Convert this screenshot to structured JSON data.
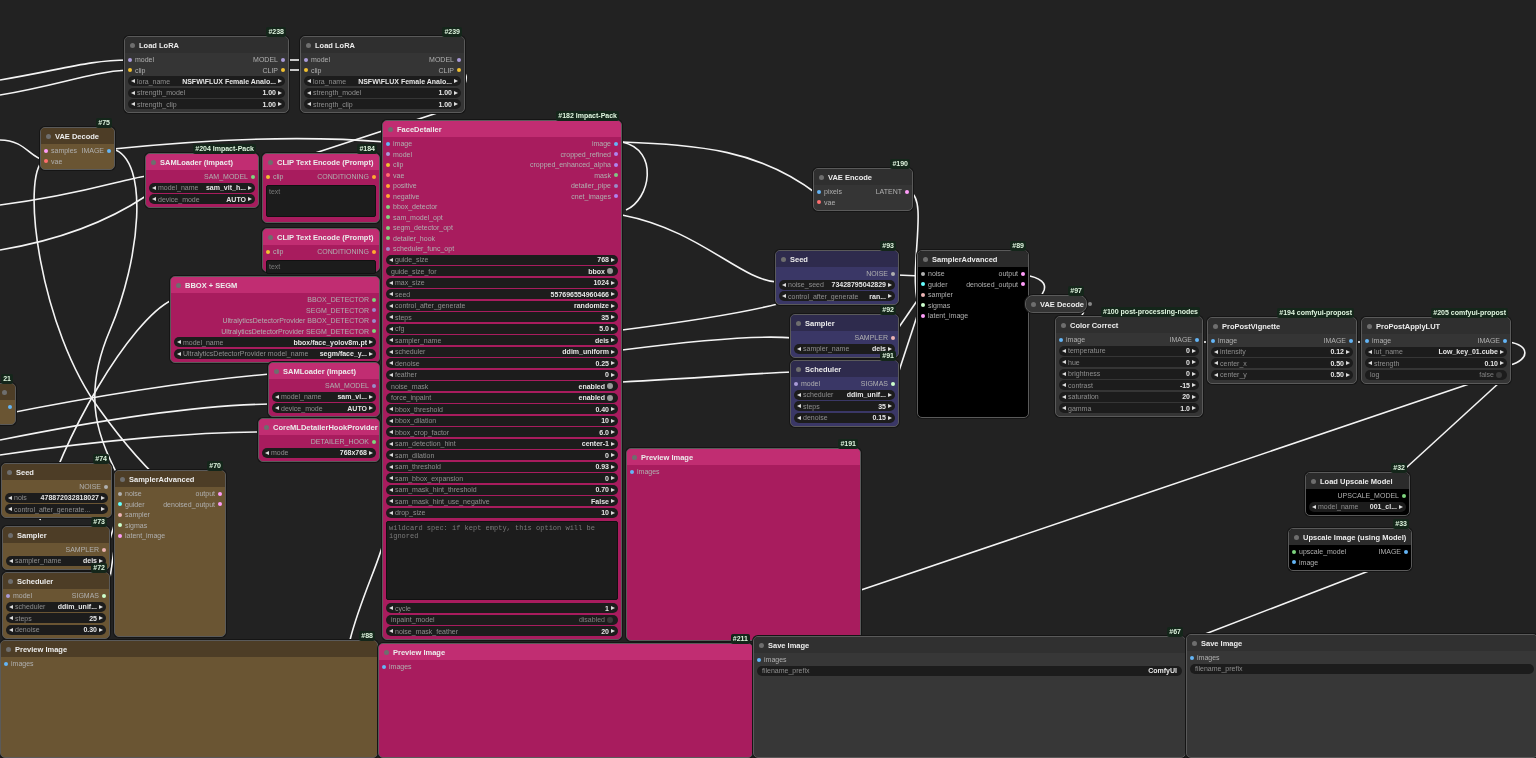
{
  "nodes": [
    {
      "title": "Load LoRA",
      "badge": "#238",
      "color": "#353535",
      "collapsed": false,
      "inputs": [
        {
          "label": "model",
          "color": "#a99bd8"
        },
        {
          "label": "clip",
          "color": "#f0c030"
        }
      ],
      "outputs": [
        {
          "label": "MODEL",
          "color": "#a99bd8"
        },
        {
          "label": "CLIP",
          "color": "#f0c030"
        }
      ],
      "widgets": [
        {
          "kind": "combo",
          "label": "lora_name",
          "value": "NSFW\\FLUX Female Analo..."
        },
        {
          "kind": "number",
          "label": "strength_model",
          "value": "1.00"
        },
        {
          "kind": "number",
          "label": "strength_clip",
          "value": "1.00"
        }
      ]
    },
    {
      "title": "Load LoRA",
      "badge": "#239",
      "color": "#353535",
      "collapsed": false,
      "inputs": [
        {
          "label": "model",
          "color": "#a99bd8"
        },
        {
          "label": "clip",
          "color": "#f0c030"
        }
      ],
      "outputs": [
        {
          "label": "MODEL",
          "color": "#a99bd8"
        },
        {
          "label": "CLIP",
          "color": "#f0c030"
        }
      ],
      "widgets": [
        {
          "kind": "combo",
          "label": "lora_name",
          "value": "NSFW\\FLUX Female Analo..."
        },
        {
          "kind": "number",
          "label": "strength_model",
          "value": "1.00"
        },
        {
          "kind": "number",
          "label": "strength_clip",
          "value": "1.00"
        }
      ]
    },
    {
      "title": "VAE Decode",
      "badge": "#75",
      "color": "#6a5533",
      "collapsed": false,
      "inputs": [
        {
          "label": "samples",
          "color": "#ff9cf9"
        },
        {
          "label": "vae",
          "color": "#ff6e6e"
        }
      ],
      "outputs": [
        {
          "label": "IMAGE",
          "color": "#64b5f6"
        }
      ]
    },
    {
      "title": "SAMLoader (Impact)",
      "badge": "#204 Impact-Pack",
      "color": "#a81c5e",
      "collapsed": false,
      "outputs": [
        {
          "label": "SAM_MODEL",
          "color": "#7ed57e"
        }
      ],
      "widgets": [
        {
          "kind": "combo",
          "label": "model_name",
          "value": "sam_vit_h..."
        },
        {
          "kind": "combo",
          "label": "device_mode",
          "value": "AUTO"
        }
      ]
    },
    {
      "title": "CLIP Text Encode (Prompt)",
      "badge": "#184",
      "color": "#a81c5e",
      "collapsed": false,
      "inputs": [
        {
          "label": "clip",
          "color": "#f0c030"
        }
      ],
      "outputs": [
        {
          "label": "CONDITIONING",
          "color": "#ffa931"
        }
      ],
      "widgets": [
        {
          "kind": "textarea",
          "placeholder": "text"
        }
      ]
    },
    {
      "title": "CLIP Text Encode (Prompt)",
      "color": "#a81c5e",
      "collapsed": false,
      "inputs": [
        {
          "label": "clip",
          "color": "#f0c030"
        }
      ],
      "outputs": [
        {
          "label": "CONDITIONING",
          "color": "#ffa931"
        }
      ],
      "widgets": [
        {
          "kind": "textarea",
          "placeholder": "text"
        }
      ]
    },
    {
      "title": "BBOX + SEGM",
      "color": "#a81c5e",
      "collapsed": false,
      "outputs": [
        {
          "label": "BBOX_DETECTOR",
          "color": "#7ed57e"
        },
        {
          "label": "SEGM_DETECTOR",
          "color": "#9a8cc8"
        },
        {
          "label": "UltralyticsDetectorProvider BBOX_DETECTOR",
          "color": "#9a8cc8"
        },
        {
          "label": "UltralyticsDetectorProvider SEGM_DETECTOR",
          "color": "#7ed57e"
        }
      ],
      "widgets": [
        {
          "kind": "combo",
          "label": "model_name",
          "value": "bbox/face_yolov8m.pt"
        },
        {
          "kind": "combo",
          "label": "UltralyticsDetectorProvider model_name",
          "value": "segm/face_y..."
        }
      ]
    },
    {
      "title": "SAMLoader (Impact)",
      "color": "#a81c5e",
      "collapsed": false,
      "outputs": [
        {
          "label": "SAM_MODEL",
          "color": "#9a8cc8"
        }
      ],
      "widgets": [
        {
          "kind": "combo",
          "label": "model_name",
          "value": "sam_vi..."
        },
        {
          "kind": "combo",
          "label": "device_mode",
          "value": "AUTO"
        }
      ]
    },
    {
      "title": "CoreMLDetailerHookProvider",
      "color": "#a81c5e",
      "collapsed": false,
      "outputs": [
        {
          "label": "DETAILER_HOOK",
          "color": "#7ed57e"
        }
      ],
      "widgets": [
        {
          "kind": "combo",
          "label": "mode",
          "value": "768x768"
        }
      ]
    },
    {
      "title": "FaceDetailer",
      "badge": "#182 Impact-Pack",
      "color": "#a81c5e",
      "collapsed": false,
      "inputs": [
        {
          "label": "image",
          "color": "#64b5f6"
        },
        {
          "label": "model",
          "color": "#a99bd8"
        },
        {
          "label": "clip",
          "color": "#f0c030"
        },
        {
          "label": "vae",
          "color": "#ff6e6e"
        },
        {
          "label": "positive",
          "color": "#ffa931"
        },
        {
          "label": "negative",
          "color": "#ffa931"
        },
        {
          "label": "bbox_detector",
          "color": "#7ed57e"
        },
        {
          "label": "sam_model_opt",
          "color": "#7ed57e"
        },
        {
          "label": "segm_detector_opt",
          "color": "#7ed57e"
        },
        {
          "label": "detailer_hook",
          "color": "#7ed57e"
        },
        {
          "label": "scheduler_func_opt",
          "color": "#9a8cc8"
        }
      ],
      "outputs": [
        {
          "label": "image",
          "color": "#64b5f6"
        },
        {
          "label": "cropped_refined",
          "color": "#b084f0"
        },
        {
          "label": "cropped_enhanced_alpha",
          "color": "#b084f0"
        },
        {
          "label": "mask",
          "color": "#81c784"
        },
        {
          "label": "detailer_pipe",
          "color": "#9a8cc8"
        },
        {
          "label": "cnet_images",
          "color": "#b084f0"
        }
      ],
      "widgets": [
        {
          "kind": "number",
          "label": "guide_size",
          "value": "768"
        },
        {
          "kind": "toggle",
          "label": "guide_size_for",
          "value": "bbox",
          "on": true
        },
        {
          "kind": "number",
          "label": "max_size",
          "value": "1024"
        },
        {
          "kind": "number",
          "label": "seed",
          "value": "557696554960466"
        },
        {
          "kind": "combo",
          "label": "control_after_generate",
          "value": "randomize"
        },
        {
          "kind": "number",
          "label": "steps",
          "value": "35"
        },
        {
          "kind": "number",
          "label": "cfg",
          "value": "5.0"
        },
        {
          "kind": "combo",
          "label": "sampler_name",
          "value": "deis"
        },
        {
          "kind": "combo",
          "label": "scheduler",
          "value": "ddim_uniform"
        },
        {
          "kind": "number",
          "label": "denoise",
          "value": "0.25"
        },
        {
          "kind": "number",
          "label": "feather",
          "value": "0"
        },
        {
          "kind": "toggle",
          "label": "noise_mask",
          "value": "enabled",
          "on": true
        },
        {
          "kind": "toggle",
          "label": "force_inpaint",
          "value": "enabled",
          "on": true
        },
        {
          "kind": "number",
          "label": "bbox_threshold",
          "value": "0.40"
        },
        {
          "kind": "number",
          "label": "bbox_dilation",
          "value": "10"
        },
        {
          "kind": "number",
          "label": "bbox_crop_factor",
          "value": "6.0"
        },
        {
          "kind": "combo",
          "label": "sam_detection_hint",
          "value": "center-1"
        },
        {
          "kind": "number",
          "label": "sam_dilation",
          "value": "0"
        },
        {
          "kind": "number",
          "label": "sam_threshold",
          "value": "0.93"
        },
        {
          "kind": "number",
          "label": "sam_bbox_expansion",
          "value": "0"
        },
        {
          "kind": "number",
          "label": "sam_mask_hint_threshold",
          "value": "0.70"
        },
        {
          "kind": "combo",
          "label": "sam_mask_hint_use_negative",
          "value": "False"
        },
        {
          "kind": "number",
          "label": "drop_size",
          "value": "10"
        },
        {
          "kind": "textarea",
          "placeholder": "wildcard spec: if kept empty, this option will be ignored"
        },
        {
          "kind": "number",
          "label": "cycle",
          "value": "1"
        },
        {
          "kind": "toggle",
          "label": "inpaint_model",
          "value": "disabled",
          "on": false
        },
        {
          "kind": "number",
          "label": "noise_mask_feather",
          "value": "20"
        }
      ]
    },
    {
      "title": "Preview Image",
      "badge": "#191",
      "color": "#a81c5e",
      "collapsed": false,
      "inputs": [
        {
          "label": "images",
          "color": "#64b5f6"
        }
      ]
    },
    {
      "title": "VAE Encode",
      "badge": "#190",
      "color": "#353535",
      "collapsed": false,
      "inputs": [
        {
          "label": "pixels",
          "color": "#64b5f6"
        },
        {
          "label": "vae",
          "color": "#ff6e6e"
        }
      ],
      "outputs": [
        {
          "label": "LATENT",
          "color": "#ff9cf9"
        }
      ]
    },
    {
      "title": "Seed",
      "badge": "#93",
      "color": "#3a3766",
      "collapsed": false,
      "outputs": [
        {
          "label": "NOISE",
          "color": "#b0b0b0"
        }
      ],
      "widgets": [
        {
          "kind": "number",
          "label": "noise_seed",
          "value": "73428795042829"
        },
        {
          "kind": "combo",
          "label": "control_after_generate",
          "value": "ran..."
        }
      ]
    },
    {
      "title": "Sampler",
      "badge": "#92",
      "color": "#3a3766",
      "collapsed": false,
      "outputs": [
        {
          "label": "SAMPLER",
          "color": "#ecb4b4"
        }
      ],
      "widgets": [
        {
          "kind": "combo",
          "label": "sampler_name",
          "value": "deis"
        }
      ]
    },
    {
      "title": "Scheduler",
      "badge": "#91",
      "color": "#3a3766",
      "collapsed": false,
      "inputs": [
        {
          "label": "model",
          "color": "#a99bd8"
        }
      ],
      "outputs": [
        {
          "label": "SIGMAS",
          "color": "#cdffcd"
        }
      ],
      "widgets": [
        {
          "kind": "combo",
          "label": "scheduler",
          "value": "ddim_unif..."
        },
        {
          "kind": "number",
          "label": "steps",
          "value": "35"
        },
        {
          "kind": "number",
          "label": "denoise",
          "value": "0.15"
        }
      ]
    },
    {
      "title": "SamplerAdvanced",
      "badge": "#89",
      "color": "#000000",
      "collapsed": false,
      "inputs": [
        {
          "label": "noise",
          "color": "#b0b0b0"
        },
        {
          "label": "guider",
          "color": "#66ffff"
        },
        {
          "label": "sampler",
          "color": "#ecb4b4"
        },
        {
          "label": "sigmas",
          "color": "#cdffcd"
        },
        {
          "label": "latent_image",
          "color": "#ff9cf9"
        }
      ],
      "outputs": [
        {
          "label": "output",
          "color": "#ff9cf9"
        },
        {
          "label": "denoised_output",
          "color": "#ff9cf9"
        }
      ]
    },
    {
      "title": "VAE Decode",
      "badge": "#97",
      "color": "#353535",
      "collapsed": true,
      "outputs": [
        {
          "color": "#888888"
        }
      ]
    },
    {
      "title": "Color Correct",
      "badge": "#100 post-processing-nodes",
      "color": "#353535",
      "collapsed": false,
      "inputs": [
        {
          "label": "image",
          "color": "#64b5f6"
        }
      ],
      "outputs": [
        {
          "label": "IMAGE",
          "color": "#64b5f6"
        }
      ],
      "widgets": [
        {
          "kind": "number",
          "label": "temperature",
          "value": "0"
        },
        {
          "kind": "number",
          "label": "hue",
          "value": "0"
        },
        {
          "kind": "number",
          "label": "brightness",
          "value": "0"
        },
        {
          "kind": "number",
          "label": "contrast",
          "value": "-15"
        },
        {
          "kind": "number",
          "label": "saturation",
          "value": "20"
        },
        {
          "kind": "number",
          "label": "gamma",
          "value": "1.0"
        }
      ]
    },
    {
      "title": "ProPostVignette",
      "badge": "#194 comfyui-propost",
      "color": "#353535",
      "collapsed": false,
      "inputs": [
        {
          "label": "image",
          "color": "#64b5f6"
        }
      ],
      "outputs": [
        {
          "label": "IMAGE",
          "color": "#64b5f6"
        }
      ],
      "widgets": [
        {
          "kind": "number",
          "label": "intensity",
          "value": "0.12"
        },
        {
          "kind": "number",
          "label": "center_x",
          "value": "0.50"
        },
        {
          "kind": "number",
          "label": "center_y",
          "value": "0.50"
        }
      ]
    },
    {
      "title": "ProPostApplyLUT",
      "badge": "#205 comfyui-propost",
      "color": "#353535",
      "collapsed": false,
      "inputs": [
        {
          "label": "image",
          "color": "#64b5f6"
        }
      ],
      "outputs": [
        {
          "label": "IMAGE",
          "color": "#64b5f6"
        }
      ],
      "widgets": [
        {
          "kind": "combo",
          "label": "lut_name",
          "value": "Low_key_01.cube"
        },
        {
          "kind": "number",
          "label": "strength",
          "value": "0.10"
        },
        {
          "kind": "toggle",
          "label": "log",
          "value": "false",
          "on": false
        }
      ]
    },
    {
      "title": "Load Upscale Model",
      "badge": "#32",
      "color": "#000000",
      "collapsed": false,
      "outputs": [
        {
          "label": "UPSCALE_MODEL",
          "color": "#7ed57e"
        }
      ],
      "widgets": [
        {
          "kind": "combo",
          "label": "model_name",
          "value": "001_cl..."
        }
      ]
    },
    {
      "title": "Upscale Image (using Model)",
      "badge": "#33",
      "color": "#000000",
      "collapsed": false,
      "inputs": [
        {
          "label": "upscale_model",
          "color": "#7ed57e"
        },
        {
          "label": "image",
          "color": "#64b5f6"
        }
      ],
      "outputs": [
        {
          "label": "IMAGE",
          "color": "#64b5f6"
        }
      ]
    },
    {
      "badge": "21",
      "color": "#6a5533",
      "collapsed": false,
      "outputs": [
        {
          "color": "#64b5f6"
        }
      ]
    },
    {
      "title": "Seed",
      "badge": "#74",
      "color": "#6a5533",
      "collapsed": false,
      "outputs": [
        {
          "label": "NOISE",
          "color": "#b0b0b0"
        }
      ],
      "widgets": [
        {
          "kind": "number",
          "label": "nois",
          "value": "478872032818027"
        },
        {
          "kind": "combo",
          "label": "control_after_generate..."
        }
      ]
    },
    {
      "title": "Sampler",
      "badge": "#73",
      "color": "#6a5533",
      "collapsed": false,
      "outputs": [
        {
          "label": "SAMPLER",
          "color": "#ecb4b4"
        }
      ],
      "widgets": [
        {
          "kind": "combo",
          "label": "sampler_name",
          "value": "deis"
        }
      ]
    },
    {
      "title": "Scheduler",
      "badge": "#72",
      "color": "#6a5533",
      "collapsed": false,
      "inputs": [
        {
          "label": "model",
          "color": "#a99bd8"
        }
      ],
      "outputs": [
        {
          "label": "SIGMAS",
          "color": "#cdffcd"
        }
      ],
      "widgets": [
        {
          "kind": "combo",
          "label": "scheduler",
          "value": "ddim_unif..."
        },
        {
          "kind": "number",
          "label": "steps",
          "value": "25"
        },
        {
          "kind": "number",
          "label": "denoise",
          "value": "0.30"
        }
      ]
    },
    {
      "title": "SamplerAdvanced",
      "badge": "#70",
      "color": "#6a5533",
      "collapsed": false,
      "inputs": [
        {
          "label": "noise",
          "color": "#b0b0b0"
        },
        {
          "label": "guider",
          "color": "#66ffff"
        },
        {
          "label": "sampler",
          "color": "#ecb4b4"
        },
        {
          "label": "sigmas",
          "color": "#cdffcd"
        },
        {
          "label": "latent_image",
          "color": "#ff9cf9"
        }
      ],
      "outputs": [
        {
          "label": "output",
          "color": "#ff9cf9"
        },
        {
          "label": "denoised_output",
          "color": "#ff9cf9"
        }
      ]
    },
    {
      "title": "Preview Image",
      "badge": "#88",
      "color": "#6a5533",
      "collapsed": false,
      "inputs": [
        {
          "label": "images",
          "color": "#64b5f6"
        }
      ]
    },
    {
      "title": "Preview Image",
      "badge": "#211",
      "color": "#a81c5e",
      "collapsed": false,
      "inputs": [
        {
          "label": "images",
          "color": "#64b5f6"
        }
      ]
    },
    {
      "title": "Save Image",
      "badge": "#67",
      "color": "#373737",
      "collapsed": false,
      "inputs": [
        {
          "label": "images",
          "color": "#64b5f6"
        }
      ],
      "widgets": [
        {
          "kind": "text",
          "label": "filename_prefix",
          "value": "ComfyUI"
        }
      ]
    },
    {
      "title": "Save Image",
      "color": "#373737",
      "collapsed": false,
      "inputs": [
        {
          "label": "images",
          "color": "#64b5f6"
        }
      ],
      "widgets": [
        {
          "kind": "text",
          "label": "filename_prefix"
        }
      ]
    }
  ]
}
